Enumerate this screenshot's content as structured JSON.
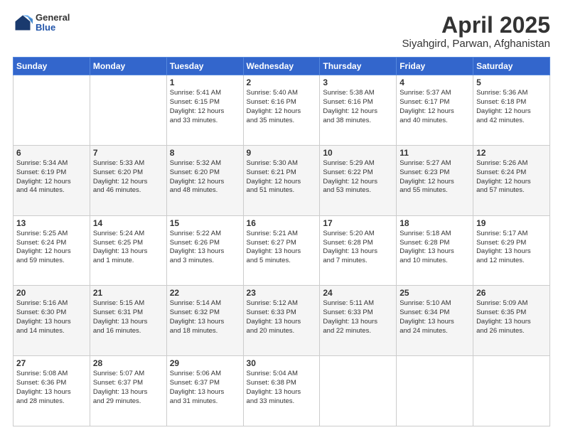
{
  "header": {
    "logo_general": "General",
    "logo_blue": "Blue",
    "title": "April 2025",
    "subtitle": "Siyahgird, Parwan, Afghanistan"
  },
  "days_of_week": [
    "Sunday",
    "Monday",
    "Tuesday",
    "Wednesday",
    "Thursday",
    "Friday",
    "Saturday"
  ],
  "weeks": [
    [
      {
        "day": "",
        "content": ""
      },
      {
        "day": "",
        "content": ""
      },
      {
        "day": "1",
        "content": "Sunrise: 5:41 AM\nSunset: 6:15 PM\nDaylight: 12 hours\nand 33 minutes."
      },
      {
        "day": "2",
        "content": "Sunrise: 5:40 AM\nSunset: 6:16 PM\nDaylight: 12 hours\nand 35 minutes."
      },
      {
        "day": "3",
        "content": "Sunrise: 5:38 AM\nSunset: 6:16 PM\nDaylight: 12 hours\nand 38 minutes."
      },
      {
        "day": "4",
        "content": "Sunrise: 5:37 AM\nSunset: 6:17 PM\nDaylight: 12 hours\nand 40 minutes."
      },
      {
        "day": "5",
        "content": "Sunrise: 5:36 AM\nSunset: 6:18 PM\nDaylight: 12 hours\nand 42 minutes."
      }
    ],
    [
      {
        "day": "6",
        "content": "Sunrise: 5:34 AM\nSunset: 6:19 PM\nDaylight: 12 hours\nand 44 minutes."
      },
      {
        "day": "7",
        "content": "Sunrise: 5:33 AM\nSunset: 6:20 PM\nDaylight: 12 hours\nand 46 minutes."
      },
      {
        "day": "8",
        "content": "Sunrise: 5:32 AM\nSunset: 6:20 PM\nDaylight: 12 hours\nand 48 minutes."
      },
      {
        "day": "9",
        "content": "Sunrise: 5:30 AM\nSunset: 6:21 PM\nDaylight: 12 hours\nand 51 minutes."
      },
      {
        "day": "10",
        "content": "Sunrise: 5:29 AM\nSunset: 6:22 PM\nDaylight: 12 hours\nand 53 minutes."
      },
      {
        "day": "11",
        "content": "Sunrise: 5:27 AM\nSunset: 6:23 PM\nDaylight: 12 hours\nand 55 minutes."
      },
      {
        "day": "12",
        "content": "Sunrise: 5:26 AM\nSunset: 6:24 PM\nDaylight: 12 hours\nand 57 minutes."
      }
    ],
    [
      {
        "day": "13",
        "content": "Sunrise: 5:25 AM\nSunset: 6:24 PM\nDaylight: 12 hours\nand 59 minutes."
      },
      {
        "day": "14",
        "content": "Sunrise: 5:24 AM\nSunset: 6:25 PM\nDaylight: 13 hours\nand 1 minute."
      },
      {
        "day": "15",
        "content": "Sunrise: 5:22 AM\nSunset: 6:26 PM\nDaylight: 13 hours\nand 3 minutes."
      },
      {
        "day": "16",
        "content": "Sunrise: 5:21 AM\nSunset: 6:27 PM\nDaylight: 13 hours\nand 5 minutes."
      },
      {
        "day": "17",
        "content": "Sunrise: 5:20 AM\nSunset: 6:28 PM\nDaylight: 13 hours\nand 7 minutes."
      },
      {
        "day": "18",
        "content": "Sunrise: 5:18 AM\nSunset: 6:28 PM\nDaylight: 13 hours\nand 10 minutes."
      },
      {
        "day": "19",
        "content": "Sunrise: 5:17 AM\nSunset: 6:29 PM\nDaylight: 13 hours\nand 12 minutes."
      }
    ],
    [
      {
        "day": "20",
        "content": "Sunrise: 5:16 AM\nSunset: 6:30 PM\nDaylight: 13 hours\nand 14 minutes."
      },
      {
        "day": "21",
        "content": "Sunrise: 5:15 AM\nSunset: 6:31 PM\nDaylight: 13 hours\nand 16 minutes."
      },
      {
        "day": "22",
        "content": "Sunrise: 5:14 AM\nSunset: 6:32 PM\nDaylight: 13 hours\nand 18 minutes."
      },
      {
        "day": "23",
        "content": "Sunrise: 5:12 AM\nSunset: 6:33 PM\nDaylight: 13 hours\nand 20 minutes."
      },
      {
        "day": "24",
        "content": "Sunrise: 5:11 AM\nSunset: 6:33 PM\nDaylight: 13 hours\nand 22 minutes."
      },
      {
        "day": "25",
        "content": "Sunrise: 5:10 AM\nSunset: 6:34 PM\nDaylight: 13 hours\nand 24 minutes."
      },
      {
        "day": "26",
        "content": "Sunrise: 5:09 AM\nSunset: 6:35 PM\nDaylight: 13 hours\nand 26 minutes."
      }
    ],
    [
      {
        "day": "27",
        "content": "Sunrise: 5:08 AM\nSunset: 6:36 PM\nDaylight: 13 hours\nand 28 minutes."
      },
      {
        "day": "28",
        "content": "Sunrise: 5:07 AM\nSunset: 6:37 PM\nDaylight: 13 hours\nand 29 minutes."
      },
      {
        "day": "29",
        "content": "Sunrise: 5:06 AM\nSunset: 6:37 PM\nDaylight: 13 hours\nand 31 minutes."
      },
      {
        "day": "30",
        "content": "Sunrise: 5:04 AM\nSunset: 6:38 PM\nDaylight: 13 hours\nand 33 minutes."
      },
      {
        "day": "",
        "content": ""
      },
      {
        "day": "",
        "content": ""
      },
      {
        "day": "",
        "content": ""
      }
    ]
  ]
}
